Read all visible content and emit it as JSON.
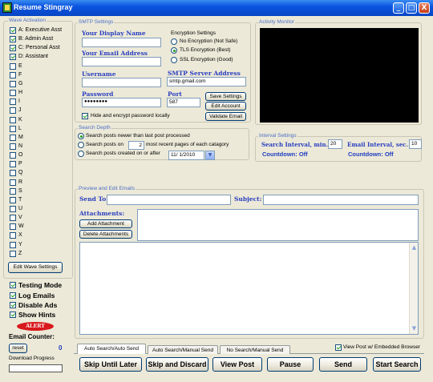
{
  "window": {
    "title": "Resume Stingray",
    "min": "_",
    "max": "□",
    "close": "X"
  },
  "wave": {
    "group_title": "Wave Activation",
    "items": [
      {
        "label": "A: Executive Asst",
        "checked": true
      },
      {
        "label": "B: Admin Asst",
        "checked": true
      },
      {
        "label": "C: Personal Asst",
        "checked": true
      },
      {
        "label": "D: Assistant",
        "checked": true
      },
      {
        "label": "E",
        "checked": false
      },
      {
        "label": "F",
        "checked": false
      },
      {
        "label": "G",
        "checked": false
      },
      {
        "label": "H",
        "checked": false
      },
      {
        "label": "I",
        "checked": false
      },
      {
        "label": "J",
        "checked": false
      },
      {
        "label": "K",
        "checked": false
      },
      {
        "label": "L",
        "checked": false
      },
      {
        "label": "M",
        "checked": false
      },
      {
        "label": "N",
        "checked": false
      },
      {
        "label": "O",
        "checked": false
      },
      {
        "label": "P",
        "checked": false
      },
      {
        "label": "Q",
        "checked": false
      },
      {
        "label": "R",
        "checked": false
      },
      {
        "label": "S",
        "checked": false
      },
      {
        "label": "T",
        "checked": false
      },
      {
        "label": "U",
        "checked": false
      },
      {
        "label": "V",
        "checked": false
      },
      {
        "label": "W",
        "checked": false
      },
      {
        "label": "X",
        "checked": false
      },
      {
        "label": "Y",
        "checked": false
      },
      {
        "label": "Z",
        "checked": false
      }
    ],
    "edit_button": "Edit Wave Settings"
  },
  "options": {
    "testing_mode": "Testing Mode",
    "log_emails": "Log Emails",
    "disable_ads": "Disable Ads",
    "show_hints": "Show Hints",
    "alert": "ALERT",
    "email_counter_label": "Email Counter:",
    "reset": "reset",
    "counter_value": "0",
    "download_progress": "Download Progress",
    "progress_value": 0
  },
  "smtp": {
    "group_title": "SMTP Settings",
    "display_name_label": "Your Display Name",
    "display_name": "",
    "email_label": "Your Email Address",
    "email": "",
    "username_label": "Username",
    "username": "",
    "password_label": "Password",
    "password": "●●●●●●●●",
    "hide_password": "Hide and encrypt password locally",
    "encryption_title": "Encryption Settings",
    "enc_none": "No Encryption (Not Safe)",
    "enc_tls": "TLS Encryption (Best)",
    "enc_ssl": "SSL Encryption (Good)",
    "server_label": "SMTP Server Address",
    "server": "smtp.gmail.com",
    "port_label": "Port",
    "port": "587",
    "save_settings": "Save Settings",
    "edit_account": "Edit Account",
    "validate_email": "Validate Email"
  },
  "activity": {
    "group_title": "Activity Monitor"
  },
  "search_depth": {
    "group_title": "Search Depth",
    "opt_newer": "Search posts newer than last post processed",
    "opt_on_prefix": "Search posts on",
    "pages": "2",
    "opt_on_suffix": "most recent pages of each catagory",
    "opt_created": "Search posts created on or after",
    "date": "11/  1/2010"
  },
  "interval": {
    "group_title": "Interval Settings",
    "search_label": "Search Interval, min.",
    "search_value": "20",
    "email_label": "Email Interval, sec.",
    "email_value": "10",
    "countdown_search": "Countdown: Off",
    "countdown_email": "Countdown: Off"
  },
  "preview": {
    "group_title": "Preview and Edit Emails",
    "send_to_label": "Send To:",
    "send_to": "",
    "subject_label": "Subject:",
    "subject": "",
    "attachments_label": "Attachments:",
    "add_attachment": "Add Attachment",
    "delete_attachments": "Delete Attachments"
  },
  "tabs": [
    "Auto Search/Auto Send",
    "Auto Search/Manual Send",
    "No Search/Manual Send"
  ],
  "view_embedded": "View Post w/ Embedded Browser",
  "actions": {
    "skip_later": "Skip Until Later",
    "skip_discard": "Skip and Discard",
    "view_post": "View Post",
    "pause": "Pause",
    "send": "Send",
    "start_search": "Start Search"
  },
  "colors": {
    "titlebar": "#0a54e0",
    "group_title": "#4c6fc6",
    "field_label": "#2a3fc0",
    "countdown": "#1f3cc0",
    "alert": "#d8191c"
  }
}
